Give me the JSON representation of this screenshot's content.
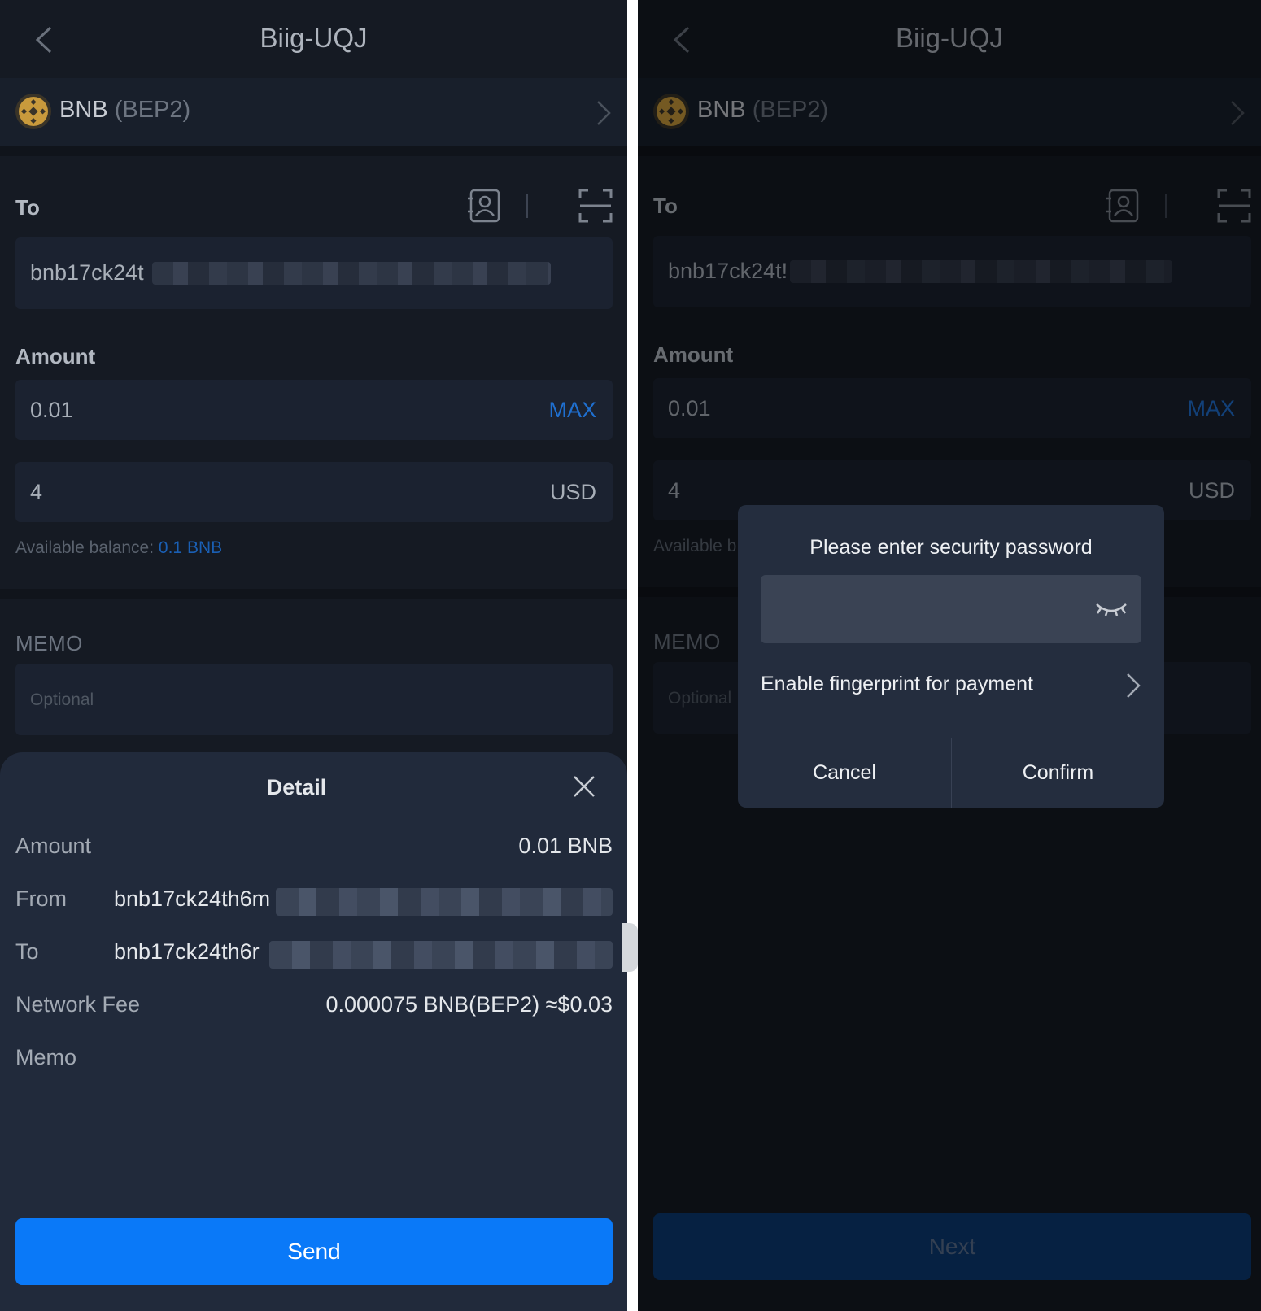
{
  "screen": {
    "title": "Biig-UQJ",
    "coin": {
      "symbol": "BNB",
      "network": "(BEP2)"
    },
    "to_label": "To",
    "to_address": "bnb17ck24t",
    "to_address_right": "bnb17ck24t!",
    "amount_label": "Amount",
    "amount_value": "0.01",
    "max_label": "MAX",
    "fiat_value": "4",
    "fiat_currency": "USD",
    "available_label": "Available balance:",
    "available_value": "0.1 BNB",
    "available_label_clipped": "Available b",
    "memo_label": "MEMO",
    "memo_placeholder": "Optional",
    "next_label": "Next"
  },
  "detail_sheet": {
    "title": "Detail",
    "amount_label": "Amount",
    "amount_value": "0.01 BNB",
    "from_label": "From",
    "from_value": "bnb17ck24th6m",
    "to_label": "To",
    "to_value": "bnb17ck24th6r",
    "fee_label": "Network Fee",
    "fee_value": "0.000075 BNB(BEP2) ≈$0.03",
    "memo_label": "Memo",
    "send_label": "Send"
  },
  "password_dialog": {
    "title": "Please enter security password",
    "password_value": "",
    "fingerprint_label": "Enable fingerprint for payment",
    "cancel_label": "Cancel",
    "confirm_label": "Confirm"
  },
  "colors": {
    "background": "#151a23",
    "accent_blue": "#0a79f8",
    "bnb_gold": "#c99a3c",
    "sheet": "#212a3b"
  },
  "icons": [
    "back-icon",
    "bnb-logo-icon",
    "chevron-right-icon",
    "contact-book-icon",
    "scan-icon",
    "close-icon",
    "eye-closed-icon"
  ]
}
